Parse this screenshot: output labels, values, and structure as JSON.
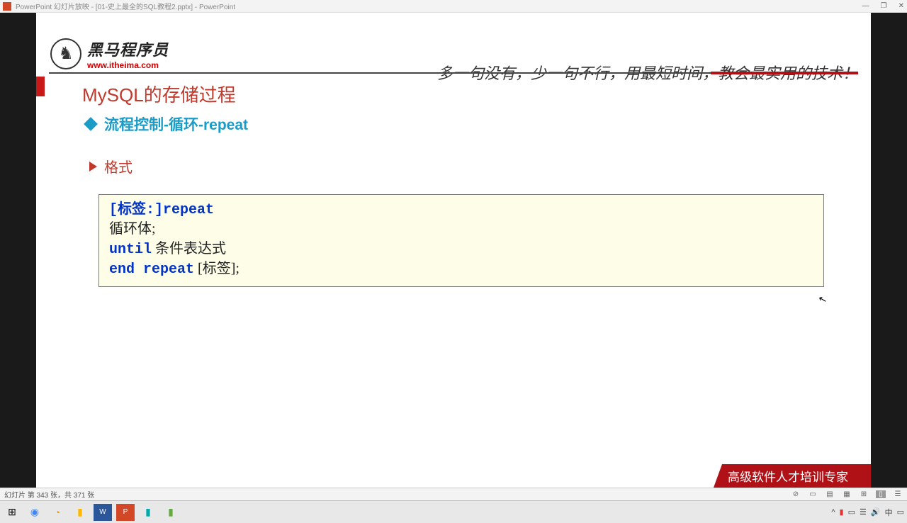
{
  "titlebar": {
    "text": "PowerPoint 幻灯片放映 - [01-史上最全的SQL教程2.pptx] - PowerPoint"
  },
  "logo": {
    "chinese": "黑马程序员",
    "url": "www.itheima.com"
  },
  "slogan": "多一句没有，少一句不行，用最短时间，教会最实用的技术！",
  "slide_title": "MySQL的存储过程",
  "subtitle": "流程控制-循环-repeat",
  "format_label": "格式",
  "code": {
    "l1a": "[标签:]",
    "l1b": "repeat",
    "l2": " 循环体;",
    "l3a": "until",
    "l3b": " 条件表达式",
    "l4a": "end",
    "l4b": " ",
    "l4c": "repeat",
    "l4d": " [标签];"
  },
  "footer_text": "高级软件人才培训专家",
  "status": "幻灯片 第 343 张，共 371 张",
  "wincontrols": {
    "min": "—",
    "max": "❐",
    "close": "✕"
  },
  "tray": {
    "chevron": "^",
    "time_ind": "中"
  }
}
